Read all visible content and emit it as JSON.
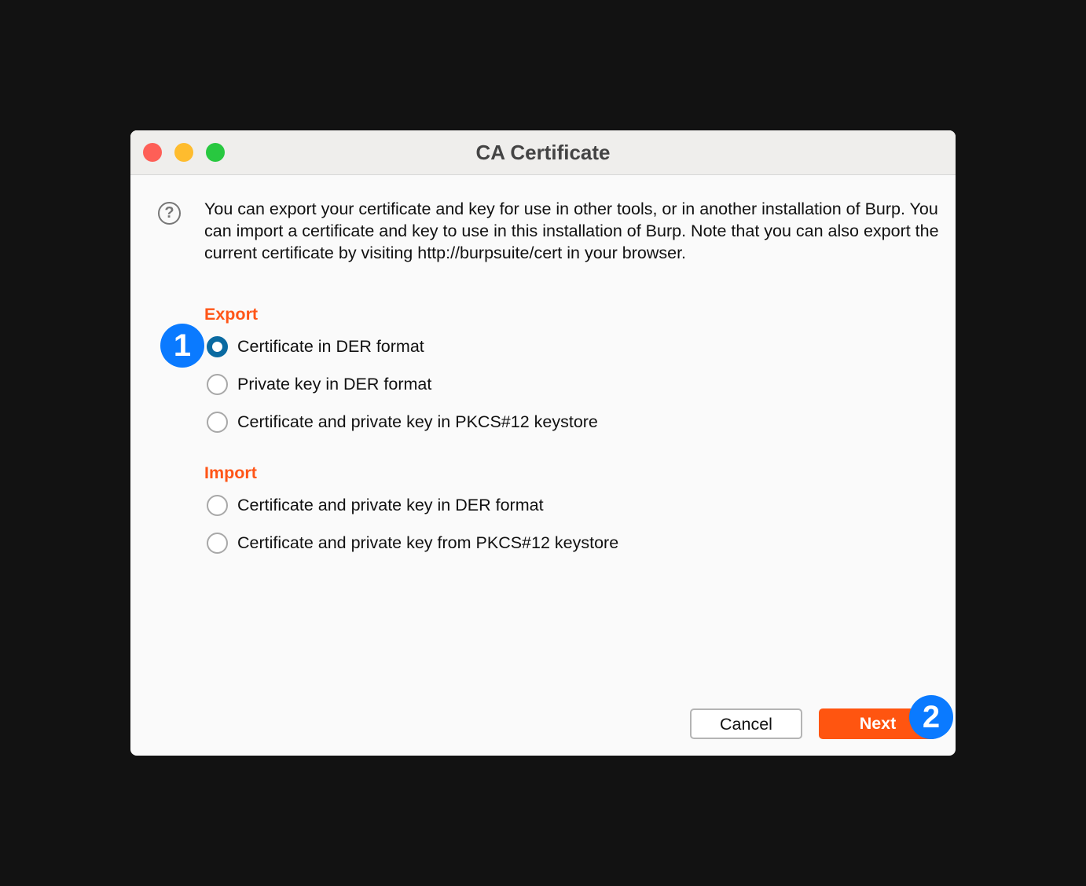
{
  "window": {
    "title": "CA Certificate",
    "controls": {
      "close_color": "#fe5f57",
      "minimize_color": "#febc2e",
      "zoom_color": "#28c840"
    }
  },
  "help_icon": "?",
  "description": "You can export your certificate and key for use in other tools, or in another installation of Burp. You can import a certificate and key to use in this installation of Burp. Note that you can also export the current certificate by visiting http://burpsuite/cert in your browser.",
  "export": {
    "heading": "Export",
    "options": [
      {
        "label": "Certificate in DER format",
        "selected": true
      },
      {
        "label": "Private key in DER format",
        "selected": false
      },
      {
        "label": "Certificate and private key in PKCS#12 keystore",
        "selected": false
      }
    ]
  },
  "import": {
    "heading": "Import",
    "options": [
      {
        "label": "Certificate and private key in DER format",
        "selected": false
      },
      {
        "label": "Certificate and private key from PKCS#12 keystore",
        "selected": false
      }
    ]
  },
  "buttons": {
    "cancel": "Cancel",
    "next": "Next"
  },
  "annotations": [
    "1",
    "2"
  ],
  "colors": {
    "accent": "#ff5517",
    "radio_selected": "#0a6aa1",
    "badge": "#0a7aff"
  }
}
